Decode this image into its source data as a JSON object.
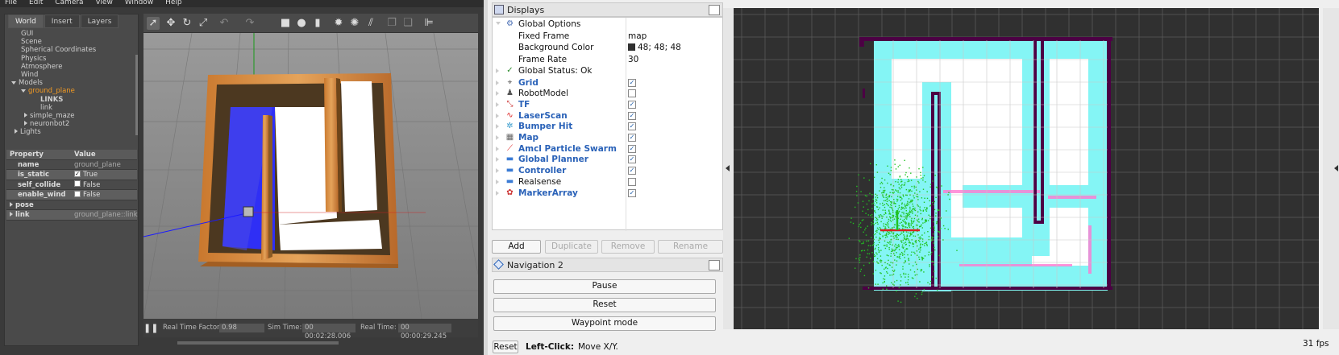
{
  "gazebo": {
    "menu": [
      "File",
      "Edit",
      "Camera",
      "View",
      "Window",
      "Help"
    ],
    "tabs": [
      "World",
      "Insert",
      "Layers"
    ],
    "tree": {
      "gui": "GUI",
      "scene": "Scene",
      "spherical": "Spherical Coordinates",
      "physics": "Physics",
      "atmosphere": "Atmosphere",
      "wind": "Wind",
      "models": "Models",
      "ground_plane": "ground_plane",
      "links": "LINKS",
      "link": "link",
      "simple_maze": "simple_maze",
      "neuronbot2": "neuronbot2",
      "lights": "Lights"
    },
    "props": {
      "col_property": "Property",
      "col_value": "Value",
      "name_key": "name",
      "name_val": "ground_plane",
      "static_key": "is_static",
      "static_val": "True",
      "collide_key": "self_collide",
      "collide_val": "False",
      "wind_key": "enable_wind",
      "wind_val": "False",
      "pose_key": "pose",
      "link_key": "link",
      "link_val": "ground_plane::link"
    },
    "status": {
      "rtf_label": "Real Time Factor:",
      "rtf_val": "0.98",
      "sim_label": "Sim Time:",
      "sim_val": "00 00:02:28.006",
      "real_label": "Real Time:",
      "real_val": "00 00:00:29.245"
    }
  },
  "rviz": {
    "displays": {
      "title": "Displays",
      "global_options": "Global Options",
      "fixed_frame_label": "Fixed Frame",
      "fixed_frame_val": "map",
      "bg_color_label": "Background Color",
      "bg_color_val": "48; 48; 48",
      "frame_rate_label": "Frame Rate",
      "frame_rate_val": "30",
      "global_status": "Global Status: Ok",
      "items": [
        {
          "label": "Grid",
          "checked": true
        },
        {
          "label": "RobotModel",
          "checked": false
        },
        {
          "label": "TF",
          "checked": true
        },
        {
          "label": "LaserScan",
          "checked": true
        },
        {
          "label": "Bumper Hit",
          "checked": true
        },
        {
          "label": "Map",
          "checked": true
        },
        {
          "label": "Amcl Particle Swarm",
          "checked": true
        },
        {
          "label": "Global Planner",
          "checked": true
        },
        {
          "label": "Controller",
          "checked": true
        },
        {
          "label": "Realsense",
          "checked": false
        },
        {
          "label": "MarkerArray",
          "checked": true
        }
      ]
    },
    "buttons": {
      "add": "Add",
      "duplicate": "Duplicate",
      "remove": "Remove",
      "rename": "Rename"
    },
    "nav": {
      "title": "Navigation 2",
      "pause": "Pause",
      "reset": "Reset",
      "waypoint": "Waypoint mode"
    },
    "statusbar": {
      "reset": "Reset",
      "hint_bold": "Left-Click:",
      "hint": "Move X/Y.",
      "fps": "31 fps"
    }
  },
  "colors": {
    "bg_swatch": "#303030",
    "accent": "#2a62b8",
    "map_free": "#ffffff",
    "inflation": "#7ef5f5"
  }
}
